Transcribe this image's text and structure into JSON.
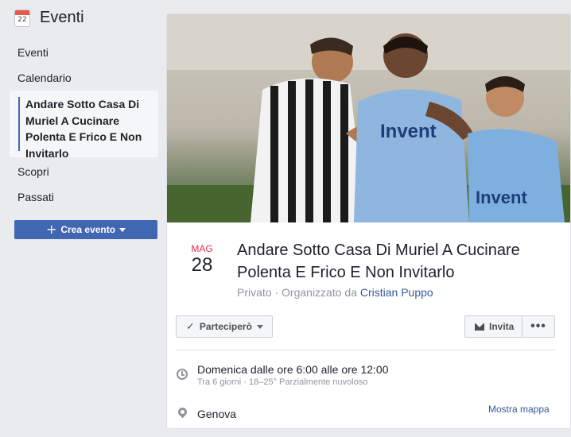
{
  "sidebar": {
    "calendar_icon_day": "22",
    "title": "Eventi",
    "items": [
      {
        "label": "Eventi"
      },
      {
        "label": "Calendario"
      },
      {
        "label": "Andare Sotto Casa Di Muriel A Cucinare Polenta E Frico E Non Invitarlo",
        "active": true
      },
      {
        "label": "Scopri"
      },
      {
        "label": "Passati"
      }
    ],
    "create_button": "Crea evento"
  },
  "event": {
    "cover_icon": "football-players-photo",
    "month": "MAG",
    "day": "28",
    "title": "Andare Sotto Casa Di Muriel A Cucinare Polenta E Frico E Non Invitarlo",
    "privacy": "Privato",
    "organized_by_prefix": "Organizzato da",
    "organizer": "Cristian Puppo",
    "going_button": "Parteciperò",
    "invite_button": "Invita",
    "more_button": "•••",
    "when": "Domenica dalle ore 6:00 alle ore 12:00",
    "when_detail": "Tra 6 giorni · 18–25° Parzialmente nuvoloso",
    "where": "Genova",
    "map_link": "Mostra mappa"
  },
  "colors": {
    "brand_blue": "#4267b2",
    "link_blue": "#365899",
    "month_red": "#f02849",
    "background": "#e9ebee"
  }
}
